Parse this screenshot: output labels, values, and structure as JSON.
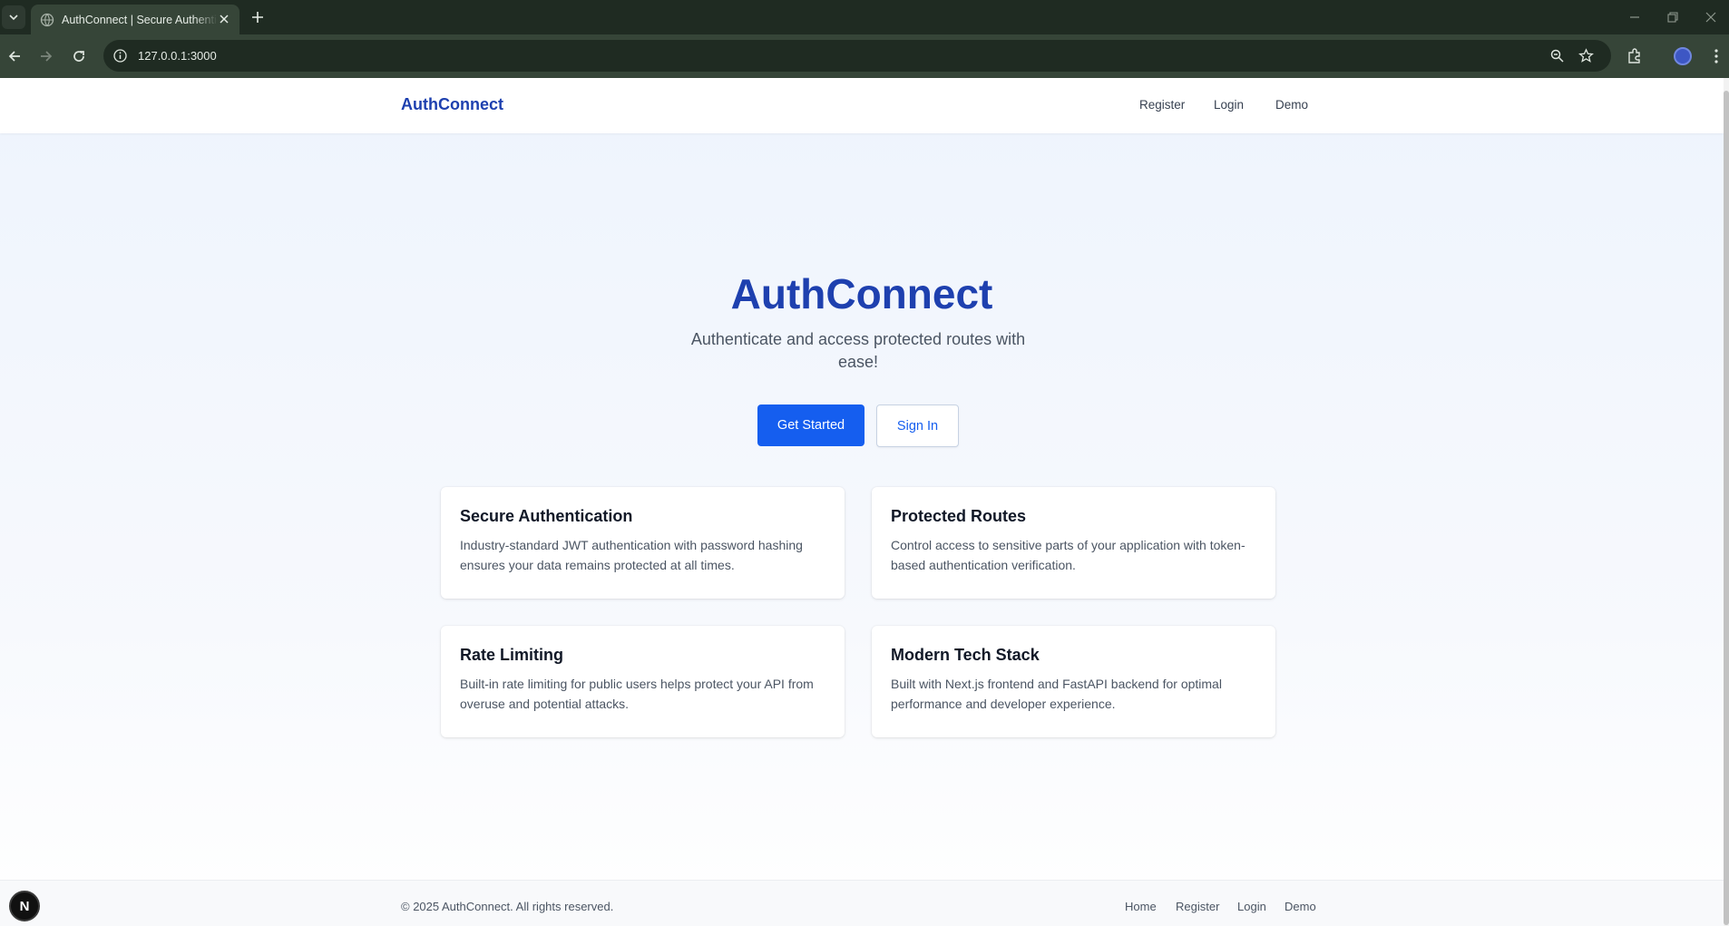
{
  "browser": {
    "tab_title": "AuthConnect | Secure Authentication",
    "url": "127.0.0.1:3000"
  },
  "header": {
    "brand": "AuthConnect",
    "nav": [
      "Register",
      "Login",
      "Demo"
    ]
  },
  "hero": {
    "title": "AuthConnect",
    "subtitle": "Authenticate and access protected routes with ease!",
    "primary_button": "Get Started",
    "secondary_button": "Sign In"
  },
  "features": [
    {
      "title": "Secure Authentication",
      "description": "Industry-standard JWT authentication with password hashing ensures your data remains protected at all times."
    },
    {
      "title": "Protected Routes",
      "description": "Control access to sensitive parts of your application with token-based authentication verification."
    },
    {
      "title": "Rate Limiting",
      "description": "Built-in rate limiting for public users helps protect your API from overuse and potential attacks."
    },
    {
      "title": "Modern Tech Stack",
      "description": "Built with Next.js frontend and FastAPI backend for optimal performance and developer experience."
    }
  ],
  "footer": {
    "copyright": "© 2025 AuthConnect. All rights reserved.",
    "links": [
      "Home",
      "Register",
      "Login",
      "Demo"
    ]
  },
  "dev_badge": "N",
  "colors": {
    "brand": "#1e40af",
    "primary": "#155eef",
    "browser_frame": "#1f2b22"
  }
}
